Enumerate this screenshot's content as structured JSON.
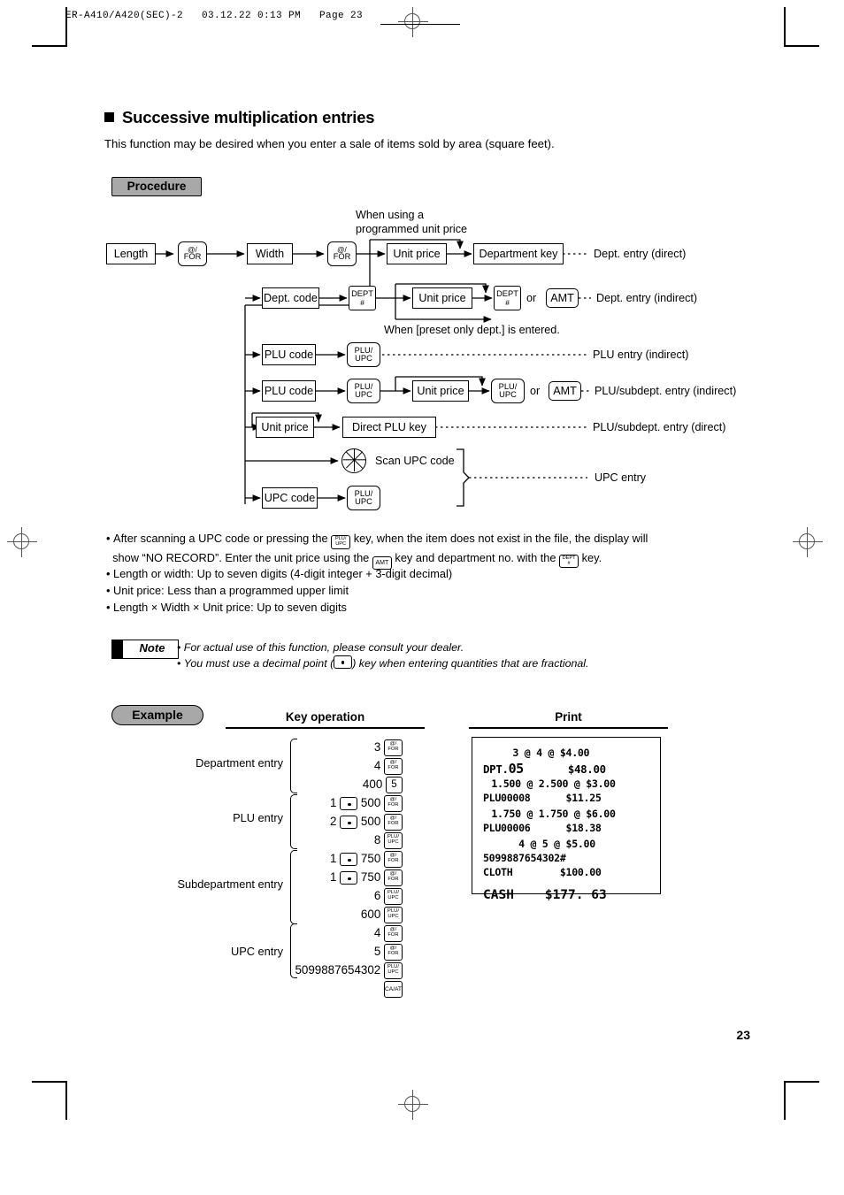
{
  "header": {
    "print_info": "ER-A410/A420(SEC)-2   03.12.22 0:13 PM   Page 23"
  },
  "page_number": "23",
  "section": {
    "title": "Successive multiplication entries",
    "lead": "This function may be desired when you enter a sale of items sold by area (square feet)."
  },
  "badges": {
    "procedure": "Procedure",
    "example": "Example"
  },
  "flow": {
    "note_top": {
      "line1": "When using a",
      "line2": "programmed unit price"
    },
    "note_preset": "When [preset only dept.] is entered.",
    "nodes": {
      "length": "Length",
      "width": "Width",
      "unit_price": "Unit price",
      "department_key": "Department key",
      "dept_code": "Dept. code",
      "plu_code": "PLU code",
      "direct_plu_key": "Direct PLU key",
      "upc_code": "UPC code",
      "scan_upc": "Scan UPC code"
    },
    "keys": {
      "at_for_top": "@/",
      "at_for_bot": "FOR",
      "dept_top": "DEPT",
      "dept_bot": "#",
      "plu_top": "PLU/",
      "plu_bot": "UPC",
      "amt": "AMT",
      "or": "or"
    },
    "labels": {
      "dept_direct": "Dept. entry (direct)",
      "dept_indirect": "Dept. entry (indirect)",
      "plu_indirect": "PLU entry (indirect)",
      "plu_subdept_indirect": "PLU/subdept. entry (indirect)",
      "plu_subdept_direct": "PLU/subdept. entry (direct)",
      "upc_entry": "UPC entry"
    }
  },
  "bullets": [
    {
      "parts": [
        "After scanning a UPC code or pressing the ",
        " key, when the item does not exist in the file, the display will"
      ],
      "line2_parts": [
        "show “NO RECORD”.  Enter the unit price using the ",
        " key and department no. with the ",
        " key."
      ]
    },
    {
      "text": "Length or width: Up to seven digits (4-digit integer + 3-digit decimal)"
    },
    {
      "text": "Unit price: Less than a programmed upper limit"
    },
    {
      "text": "Length × Width × Unit price: Up to seven digits"
    }
  ],
  "note": {
    "label": "Note",
    "item1": "For actual use of this function, please consult your dealer.",
    "item2_a": "You must use a decimal point (",
    "item2_b": ") key when entering quantities that are fractional."
  },
  "example": {
    "col_key": "Key operation",
    "col_print": "Print",
    "groups": [
      {
        "label": "Department entry",
        "rows": [
          {
            "digits": "3",
            "key": "at_for"
          },
          {
            "digits": "4",
            "key": "at_for"
          },
          {
            "digits": "400",
            "key": "num5"
          }
        ]
      },
      {
        "label": "PLU entry",
        "rows": [
          {
            "digits": "1",
            "dot": true,
            "digits2": "500",
            "key": "at_for"
          },
          {
            "digits": "2",
            "dot": true,
            "digits2": "500",
            "key": "at_for"
          },
          {
            "digits": "8",
            "key": "plu_upc"
          }
        ]
      },
      {
        "label": "Subdepartment entry",
        "rows": [
          {
            "digits": "1",
            "dot": true,
            "digits2": "750",
            "key": "at_for"
          },
          {
            "digits": "1",
            "dot": true,
            "digits2": "750",
            "key": "at_for"
          },
          {
            "digits": "6",
            "key": "plu_upc"
          },
          {
            "digits": "600",
            "key": "plu_upc"
          }
        ]
      },
      {
        "label": "UPC entry",
        "rows": [
          {
            "digits": "4",
            "key": "at_for"
          },
          {
            "digits": "5",
            "key": "at_for"
          },
          {
            "digits": "5099887654302",
            "key": "plu_upc"
          },
          {
            "digits": "",
            "key": "ca_at"
          }
        ]
      }
    ],
    "keycaps": {
      "at_for": "@/ FOR",
      "num5": "5",
      "plu_upc": "PLU/ UPC",
      "ca_at": "CA/AT"
    }
  },
  "receipt": {
    "lines": [
      {
        "text": "     3 @ 4 @ $4.00"
      },
      {
        "text": "DPT.05        $48.00"
      },
      {
        "text": "  1.500 @ 2.500 @ $3.00"
      },
      {
        "text": "PLU00008      $11.25"
      },
      {
        "text": "  1.750 @ 1.750 @ $6.00"
      },
      {
        "text": "PLU00006      $18.38"
      },
      {
        "text": "      4 @ 5 @ $5.00"
      },
      {
        "text": "5099887654302#"
      },
      {
        "text": "CLOTH        $100.00"
      },
      {
        "text": "CASH    $177. 63"
      }
    ]
  }
}
